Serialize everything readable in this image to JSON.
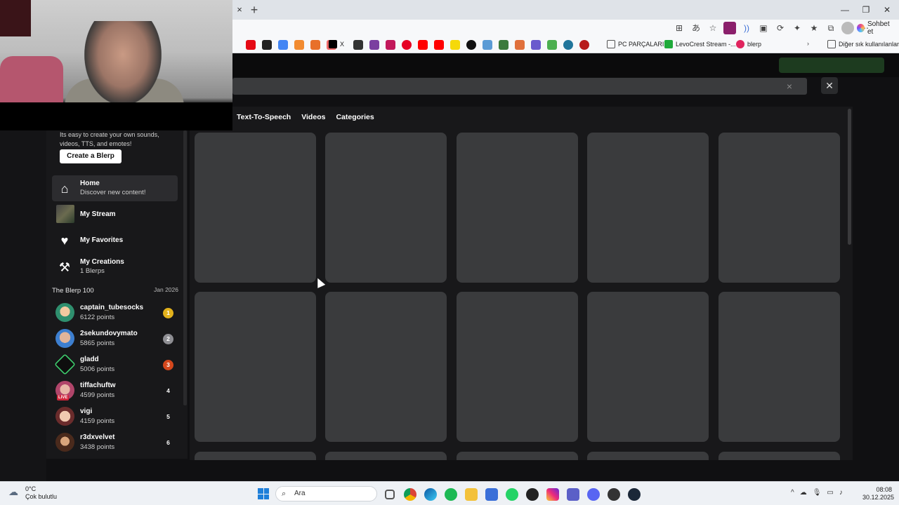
{
  "browser": {
    "tab_close": "×",
    "new_tab": "+",
    "copilot_label": "Sohbet et",
    "bookmarks": {
      "x_label": "X",
      "pc_parcalari": "PC PARÇALARI",
      "levocrest": "LevoCrest Stream -...",
      "blerp": "blerp",
      "other_bookmarks": "Diğer sık kullanılanlar"
    }
  },
  "search": {
    "clear": "×",
    "close": "✕"
  },
  "sidebar": {
    "promo_text": "Its easy to create your own sounds, videos, TTS, and emotes!",
    "create_button": "Create a Blerp",
    "nav": [
      {
        "title": "Home",
        "subtitle": "Discover new content!"
      },
      {
        "title": "My Stream",
        "subtitle": ""
      },
      {
        "title": "My Favorites",
        "subtitle": ""
      },
      {
        "title": "My Creations",
        "subtitle": "1 Blerps"
      }
    ],
    "blerp100": {
      "title": "The Blerp 100",
      "date": "Jan 2026",
      "entries": [
        {
          "name": "captain_tubesocks",
          "points": "6122 points",
          "rank": "1",
          "rank_color": "#e3b21c"
        },
        {
          "name": "2sekundovymato",
          "points": "5865 points",
          "rank": "2",
          "rank_color": "#8e8e93"
        },
        {
          "name": "gladd",
          "points": "5006 points",
          "rank": "3",
          "rank_color": "#d4471c"
        },
        {
          "name": "tiffachuftw",
          "points": "4599 points",
          "rank": "4",
          "rank_color": "transparent",
          "live": "LIVE"
        },
        {
          "name": "vigi",
          "points": "4159 points",
          "rank": "5",
          "rank_color": "transparent"
        },
        {
          "name": "r3dxvelvet",
          "points": "3438 points",
          "rank": "6",
          "rank_color": "transparent"
        }
      ]
    }
  },
  "content": {
    "tabs": [
      "Text-To-Speech",
      "Videos",
      "Categories"
    ]
  },
  "taskbar": {
    "temperature": "0°C",
    "weather": "Çok bulutlu",
    "search_placeholder": "Ara",
    "time": "08:08",
    "date": "30.12.2025"
  }
}
